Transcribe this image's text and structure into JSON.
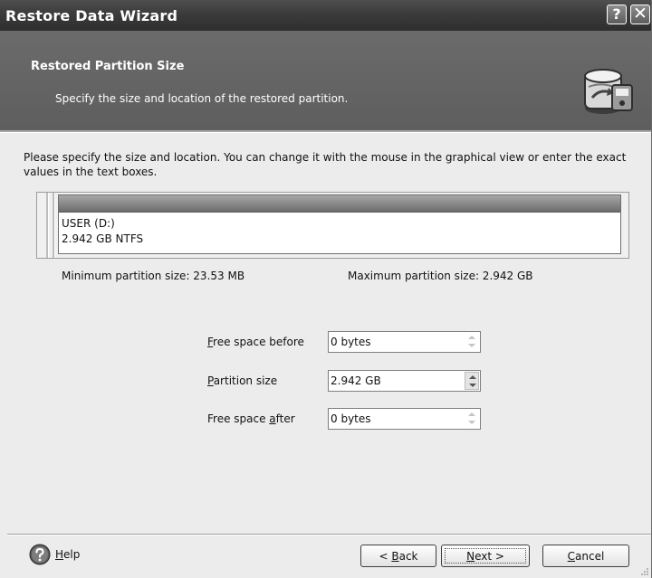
{
  "window": {
    "title": "Restore Data Wizard",
    "help_glyph": "?",
    "close_glyph": "✕"
  },
  "header": {
    "title": "Restored Partition Size",
    "subtitle": "Specify the size and location of the restored partition.",
    "icon": "restore-wizard-icon"
  },
  "instructions": "Please specify the size and location. You can change it with the mouse in the graphical view or enter the exact values in the text boxes.",
  "partition": {
    "name": "USER (D:)",
    "info": "2.942 GB  NTFS"
  },
  "limits": {
    "min": "Minimum partition size:  23.53 MB",
    "max": "Maximum partition size:  2.942 GB"
  },
  "fields": {
    "free_before": {
      "label_pre": "",
      "label_key": "F",
      "label_post": "ree space before",
      "value": "0 bytes"
    },
    "partition_size": {
      "label_pre": "",
      "label_key": "P",
      "label_post": "artition size",
      "value": "2.942 GB"
    },
    "free_after": {
      "label_pre": "Free space ",
      "label_key": "a",
      "label_post": "fter",
      "value": "0 bytes"
    }
  },
  "footer": {
    "help_label_key": "H",
    "help_label_rest": "elp",
    "back_pre": "< ",
    "back_key": "B",
    "back_post": "ack",
    "next_key": "N",
    "next_post": "ext >",
    "cancel_key": "C",
    "cancel_post": "ancel"
  },
  "colors": {
    "titlebar": "#3b3b3b",
    "header": "#636363",
    "window_bg": "#ececec"
  }
}
